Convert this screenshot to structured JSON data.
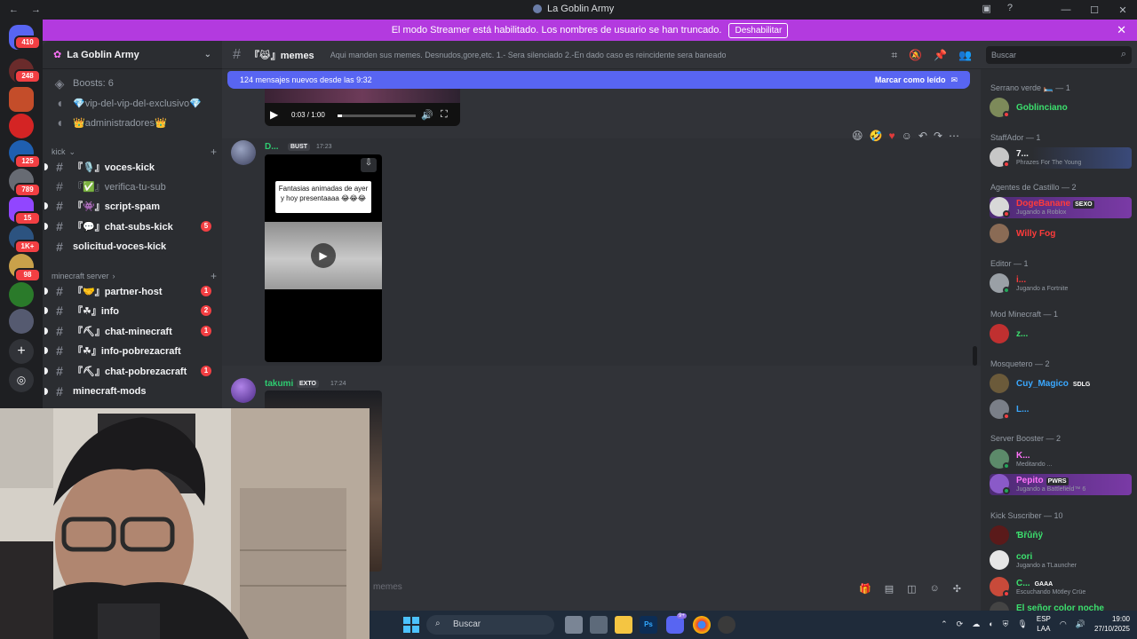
{
  "window": {
    "title": "La Goblin Army"
  },
  "banner": {
    "text": "El modo Streamer está habilitado. Los nombres de usuario se han truncado.",
    "button": "Deshabilitar"
  },
  "rail_badges": [
    "410",
    "248",
    "125",
    "789",
    "15",
    "1K+",
    "98"
  ],
  "server": {
    "name": "La Goblin Army"
  },
  "sidebar": {
    "top_items": [
      {
        "label": "Boosts: 6"
      },
      {
        "label": "💎vip-del-vip-del-exclusivo💎"
      },
      {
        "label": "👑administradores👑"
      }
    ],
    "categories": [
      "kick",
      "minecraft server"
    ],
    "channels": [
      {
        "label": "『🎙️』voces-kick",
        "badge": ""
      },
      {
        "label": "『✅』verifica-tu-sub",
        "badge": ""
      },
      {
        "label": "『👾』script-spam",
        "badge": ""
      },
      {
        "label": "『💬』chat-subs-kick",
        "badge": "5"
      },
      {
        "label": "solicitud-voces-kick",
        "badge": ""
      },
      {
        "label": "『🤝』partner-host",
        "badge": "1"
      },
      {
        "label": "『☘』info",
        "badge": "2"
      },
      {
        "label": "『⛏』chat-minecraft",
        "badge": "1"
      },
      {
        "label": "『☘』info-pobrezacraft",
        "badge": ""
      },
      {
        "label": "『⛏』chat-pobrezacraft",
        "badge": "1"
      },
      {
        "label": "minecraft-mods",
        "badge": ""
      }
    ]
  },
  "channel": {
    "name": "『😹』memes",
    "topic": "Aqui manden sus memes. Desnudos,gore,etc. 1.- Sera silenciado 2.-En dado caso es reincidente sera baneado"
  },
  "search": {
    "placeholder": "Buscar"
  },
  "new_messages": {
    "text": "124 mensajes nuevos desde las 9:32",
    "mark": "Marcar como leído"
  },
  "video_player": {
    "time": "0:03 / 1:00"
  },
  "messages": [
    {
      "user": "D...",
      "tag": "BUST",
      "time": "17:23",
      "video_caption": "Fantasias animadas de ayer y hoy presentaaaa 😂😂😂"
    },
    {
      "user": "takumi",
      "tag": "EXTO",
      "time": "17:24"
    }
  ],
  "composer": {
    "placeholder": "memes"
  },
  "members": {
    "groups": [
      {
        "role": "Serrano verde 🛏️ — 1",
        "items": [
          {
            "name": "Goblinciano",
            "activity": "",
            "tag": ""
          }
        ]
      },
      {
        "role": "StaffAdor — 1",
        "items": [
          {
            "name": "7...",
            "activity": "Phrazes For The Young",
            "tag": ""
          }
        ]
      },
      {
        "role": "Agentes de Castillo — 2",
        "items": [
          {
            "name": "DogeBanane",
            "activity": "Jugando a Roblox",
            "tag": "SEXO"
          },
          {
            "name": "Willy Fog",
            "activity": "",
            "tag": ""
          }
        ]
      },
      {
        "role": "Editor — 1",
        "items": [
          {
            "name": "i...",
            "activity": "Jugando a Fortnite",
            "tag": ""
          }
        ]
      },
      {
        "role": "Mod Minecraft — 1",
        "items": [
          {
            "name": "z...",
            "activity": "",
            "tag": ""
          }
        ]
      },
      {
        "role": "Mosquetero — 2",
        "items": [
          {
            "name": "Cuy_Magico",
            "activity": "",
            "tag": "SDLG"
          },
          {
            "name": "L...",
            "activity": "",
            "tag": ""
          }
        ]
      },
      {
        "role": "Server Booster — 2",
        "items": [
          {
            "name": "K...",
            "activity": "Meditando ...",
            "tag": ""
          },
          {
            "name": "Pepito",
            "activity": "Jugando a Battlefield™ 6",
            "tag": "PWRS"
          }
        ]
      },
      {
        "role": "Kick Suscriber — 10",
        "items": [
          {
            "name": "Ɓřůňÿ",
            "activity": "",
            "tag": ""
          },
          {
            "name": "cori",
            "activity": "Jugando a TLauncher",
            "tag": ""
          },
          {
            "name": "C...",
            "activity": "Escuchando Mötley Crüe",
            "tag": "GAAA"
          },
          {
            "name": "El señor color noche",
            "activity": "",
            "tag": ""
          }
        ]
      }
    ]
  },
  "taskbar": {
    "search": "Buscar",
    "lang": [
      "ESP",
      "LAA"
    ],
    "time": "19:00",
    "date": "27/10/2025",
    "discord_badge": "9+"
  },
  "colors": {
    "banner": "#b33adf",
    "new_bar": "#5865f2",
    "accent_green": "#23a55a",
    "badge_red": "#f23f43"
  }
}
